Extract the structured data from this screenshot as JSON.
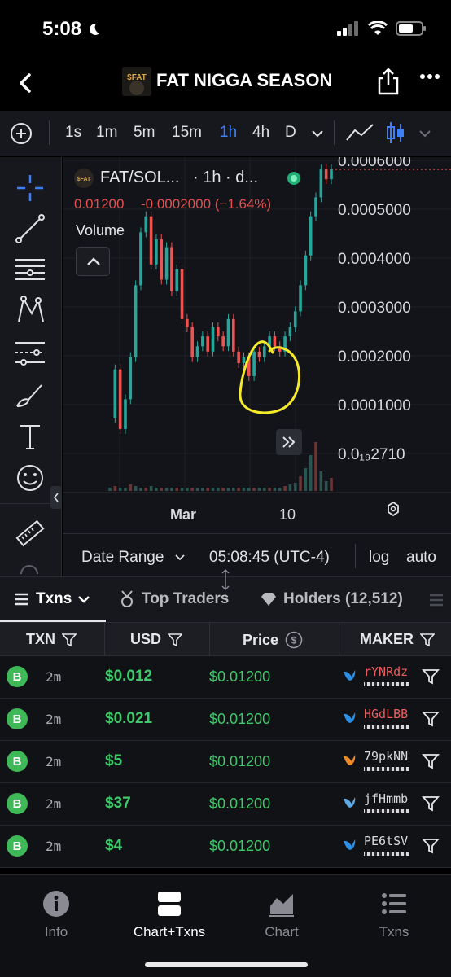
{
  "status_bar": {
    "time": "5:08",
    "icons": [
      "moon-icon",
      "signal-icon",
      "wifi-icon",
      "battery-icon"
    ]
  },
  "header": {
    "title": "FAT NIGGA SEASON",
    "logo_text": "$FAT"
  },
  "timeframes": {
    "items": [
      "1s",
      "1m",
      "5m",
      "15m",
      "1h",
      "4h",
      "D"
    ],
    "active": "1h"
  },
  "chart_header": {
    "pair": "FAT/SOL...",
    "interval": "· 1h · d...",
    "price": "0.01200",
    "change": "-0.0002000 (−1.64%)",
    "volume_label": "Volume"
  },
  "chart_data": {
    "type": "line",
    "scale": "log",
    "y_tick_labels": [
      "0.0006000",
      "0.0005000",
      "0.0004000",
      "0.0003000",
      "0.0002000",
      "0.0001000",
      "0.0₁₉2710"
    ],
    "x_tick_labels": [
      "Mar",
      "10"
    ],
    "series": [
      {
        "values": [
          5e-05,
          8e-05,
          4.5e-05,
          6e-05,
          9e-05,
          0.00018,
          0.0003,
          0.00035,
          0.00022,
          0.00028,
          0.00019,
          0.00026,
          0.00017,
          0.00021,
          0.00013,
          0.00012,
          9e-05,
          0.0001,
          0.00011,
          9.5e-05,
          0.00012,
          0.00011,
          0.0001,
          0.00013,
          9.5e-05,
          8.5e-05,
          9e-05,
          7.5e-05,
          9.5e-05,
          9e-05,
          0.0001,
          0.00011,
          0.0001,
          9.5e-05,
          0.00011,
          0.00012,
          0.00014,
          0.00018,
          0.00024,
          0.00035,
          0.00042,
          0.00055,
          0.0005,
          0.00055
        ]
      }
    ],
    "volume": [
      2,
      3,
      2,
      2,
      4,
      3,
      2,
      2,
      3,
      2,
      2,
      2,
      2,
      2,
      2,
      2,
      2,
      2,
      2,
      2,
      2,
      2,
      2,
      2,
      2,
      2,
      2,
      2,
      2,
      2,
      2,
      2,
      2,
      2,
      3,
      4,
      5,
      9,
      14,
      22,
      30,
      12,
      6,
      8
    ]
  },
  "chart_footer": {
    "date_range_label": "Date Range",
    "time_display": "05:08:45 (UTC-4)",
    "log_label": "log",
    "auto_label": "auto"
  },
  "tabs": [
    {
      "label": "Txns",
      "icon": "menu-icon",
      "active": true
    },
    {
      "label": "Top Traders",
      "icon": "medal-icon"
    },
    {
      "label": "Holders (12,512)",
      "icon": "diamond-icon"
    }
  ],
  "table": {
    "headers": [
      "TXN",
      "USD",
      "Price",
      "MAKER"
    ],
    "rows": [
      {
        "type": "B",
        "age": "2m",
        "usd": "$0.012",
        "price": "$0.01200",
        "maker": "rYNRdz",
        "maker_color": "#e85d5d",
        "icon_color": "#2b8fe6"
      },
      {
        "type": "B",
        "age": "2m",
        "usd": "$0.021",
        "price": "$0.01200",
        "maker": "HGdLBB",
        "maker_color": "#e85d5d",
        "icon_color": "#2b8fe6"
      },
      {
        "type": "B",
        "age": "2m",
        "usd": "$5",
        "price": "$0.01200",
        "maker": "79pkNN",
        "maker_color": "#d7d8dc",
        "icon_color": "#f08a24"
      },
      {
        "type": "B",
        "age": "2m",
        "usd": "$37",
        "price": "$0.01200",
        "maker": "jfHmmb",
        "maker_color": "#d7d8dc",
        "icon_color": "#5aa9e6"
      },
      {
        "type": "B",
        "age": "2m",
        "usd": "$4",
        "price": "$0.01200",
        "maker": "PE6tSV",
        "maker_color": "#d7d8dc",
        "icon_color": "#2b8fe6"
      }
    ]
  },
  "bottom_nav": [
    {
      "label": "Info",
      "icon": "info-icon"
    },
    {
      "label": "Chart+Txns",
      "icon": "chart-txns-icon",
      "active": true
    },
    {
      "label": "Chart",
      "icon": "area-chart-icon"
    },
    {
      "label": "Txns",
      "icon": "list-icon"
    }
  ],
  "colors": {
    "green": "#3fc76b",
    "red": "#e5504f",
    "accent": "#3f7ff5",
    "candle_up": "#26a69a",
    "candle_down": "#ef5350",
    "annotation": "#f4ea2a"
  }
}
